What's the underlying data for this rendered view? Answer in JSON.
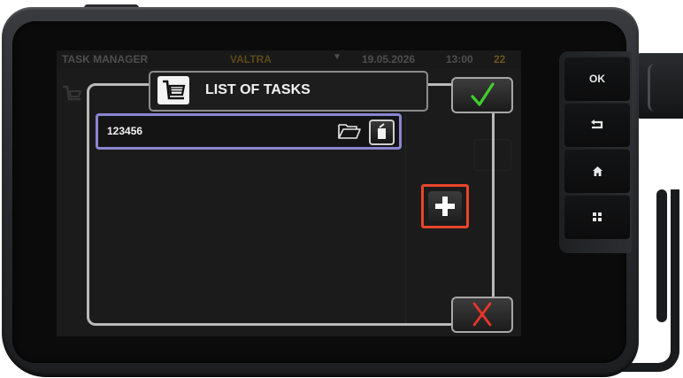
{
  "status_bar": {
    "title": "TASK MANAGER",
    "vehicle": "VALTRA",
    "dropdown_glyph": "▼",
    "date": "19.05.2026",
    "time": "13:00",
    "count": "22"
  },
  "dialog": {
    "title": "LIST OF TASKS",
    "icon": "task-list-icon",
    "confirm_icon": "checkmark-icon",
    "cancel_icon": "close-x-icon"
  },
  "tasks": [
    {
      "name": "123456",
      "open_icon": "folder-open-icon",
      "delete_icon": "trash-icon"
    }
  ],
  "add_button": {
    "icon": "plus-icon"
  },
  "hardware_keys": {
    "ok": "OK",
    "back_icon": "back-arrow-icon",
    "home_icon": "home-icon",
    "menu_icon": "grid-menu-icon"
  },
  "colors": {
    "task_highlight": "#8b85d2",
    "confirm_green": "#3fcf2b",
    "cancel_red": "#e8352a",
    "add_border": "#e8462a"
  }
}
